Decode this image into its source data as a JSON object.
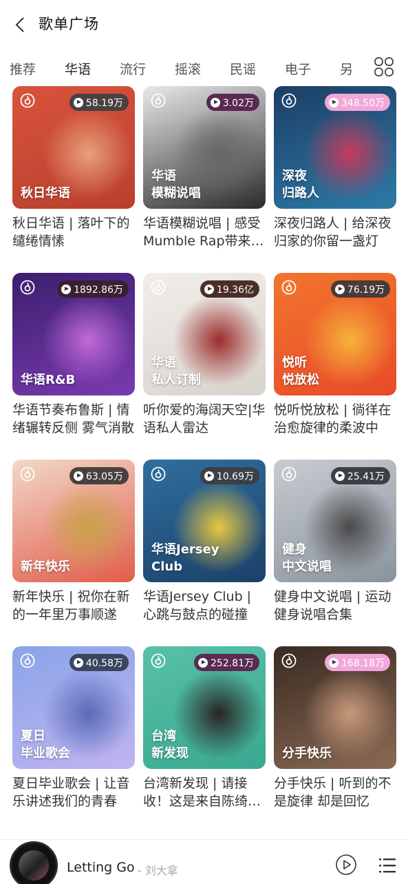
{
  "header": {
    "title": "歌单广场"
  },
  "tabs": [
    {
      "label": "推荐",
      "active": false
    },
    {
      "label": "华语",
      "active": true
    },
    {
      "label": "流行",
      "active": false
    },
    {
      "label": "摇滚",
      "active": false
    },
    {
      "label": "民谣",
      "active": false
    },
    {
      "label": "电子",
      "active": false
    },
    {
      "label": "另",
      "active": false
    }
  ],
  "playlists": [
    {
      "count": "58.19万",
      "cover_label": "秋日华语",
      "title": "秋日华语 | 落叶下的缱绻情愫",
      "pill_color": "#4a4040",
      "art": [
        "#d9533d",
        "#b8402e",
        "#e8a07a"
      ]
    },
    {
      "count": "3.02万",
      "cover_label": "华语\n模糊说唱",
      "title": "华语模糊说唱 | 感受Mumble Rap带来的松弛氛围",
      "pill_color": "#5a2a50",
      "art": [
        "#e8e8e8",
        "#2b2b2b",
        "#666666"
      ]
    },
    {
      "count": "348.50万",
      "cover_label": "深夜\n归路人",
      "title": "深夜归路人 | 给深夜归家的你留一盏灯",
      "pill_color": "#f1a8d8",
      "art": [
        "#1d3e66",
        "#2c7ba8",
        "#c83a5a"
      ]
    },
    {
      "count": "1892.86万",
      "cover_label": "华语R&B",
      "title": "华语节奏布鲁斯 | 情绪辗转反侧 雾气消散",
      "pill_color": "#3a2030",
      "art": [
        "#3b1f6e",
        "#7b3bb0",
        "#c06ad8"
      ]
    },
    {
      "count": "19.36亿",
      "cover_label": "华语\n私人订制",
      "title": "听你爱的海阔天空|华语私人雷达",
      "pill_color": "#4a2f28",
      "art": [
        "#f1eeea",
        "#d8d2cc",
        "#9a2c2c"
      ]
    },
    {
      "count": "76.19万",
      "cover_label": "悦听\n悦放松",
      "title": "悦听悦放松 | 徜徉在治愈旋律的柔波中",
      "pill_color": "#4a3a38",
      "art": [
        "#f2752c",
        "#e84a2a",
        "#f6b23c"
      ]
    },
    {
      "count": "63.05万",
      "cover_label": "新年快乐",
      "title": "新年快乐 | 祝你在新的一年里万事顺遂",
      "pill_color": "#4a4040",
      "art": [
        "#f2d8c8",
        "#e25c4a",
        "#c8a24a"
      ]
    },
    {
      "count": "10.69万",
      "cover_label": "华语Jersey\nClub",
      "title": "华语Jersey Club | 心跳与鼓点的碰撞",
      "pill_color": "#3a4046",
      "art": [
        "#2f6fa0",
        "#1c4068",
        "#e8c840"
      ]
    },
    {
      "count": "25.41万",
      "cover_label": "健身\n中文说唱",
      "title": "健身中文说唱 | 运动健身说唱合集",
      "pill_color": "#3a4046",
      "art": [
        "#c8ccd2",
        "#8a939c",
        "#4a4a4a"
      ]
    },
    {
      "count": "40.58万",
      "cover_label": "夏日\n毕业歌会",
      "title": "夏日毕业歌会 | 让音乐讲述我们的青春",
      "pill_color": "#3a4660",
      "art": [
        "#8aa4e8",
        "#c0b4f0",
        "#5a6ab8"
      ]
    },
    {
      "count": "252.81万",
      "cover_label": "台湾\n新发现",
      "title": "台湾新发现 | 请接收！这是来自陈绮贞的问候",
      "pill_color": "#5a2a50",
      "art": [
        "#58c0a8",
        "#3aa890",
        "#2a2424"
      ]
    },
    {
      "count": "168.18万",
      "cover_label": "分手快乐",
      "title": "分手快乐 | 听到的不是旋律 却是回忆",
      "pill_color": "#f1a8d8",
      "art": [
        "#3a2a22",
        "#8a6a54",
        "#c89a7a"
      ]
    }
  ],
  "player": {
    "song": "Letting Go",
    "artist": "- 刘大拿"
  }
}
